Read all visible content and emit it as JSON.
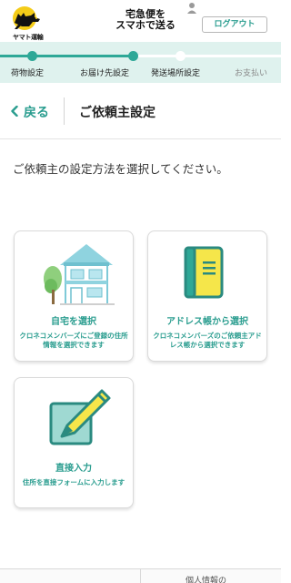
{
  "header": {
    "logo_text": "ヤマト運輸",
    "service_title_line1": "宅急便を",
    "service_title_line2": "スマホで送る",
    "logout_label": "ログアウト"
  },
  "progress": {
    "steps": [
      {
        "label": "荷物設定"
      },
      {
        "label": "お届け先設定"
      },
      {
        "label": "発送場所設定"
      },
      {
        "label": "お支払い"
      }
    ],
    "current_step": 2
  },
  "page": {
    "back_label": "戻る",
    "title": "ご依頼主設定",
    "instruction": "ご依頼主の設定方法を選択してください。"
  },
  "options": [
    {
      "title": "自宅を選択",
      "desc": "クロネコメンバーズにご登録の住所情報を選択できます"
    },
    {
      "title": "アドレス帳から選択",
      "desc": "クロネコメンバーズのご依頼主アドレス帳から選択できます"
    },
    {
      "title": "直接入力",
      "desc": "住所を直接フォームに入力します"
    }
  ],
  "footer": {
    "privacy_label": "個人情報の"
  },
  "colors": {
    "accent": "#2a9d8f",
    "progress_bg": "#dff2ee",
    "progress_done": "#2ea897",
    "book_yellow": "#f5e64a",
    "house_blue": "#8fd3df"
  }
}
